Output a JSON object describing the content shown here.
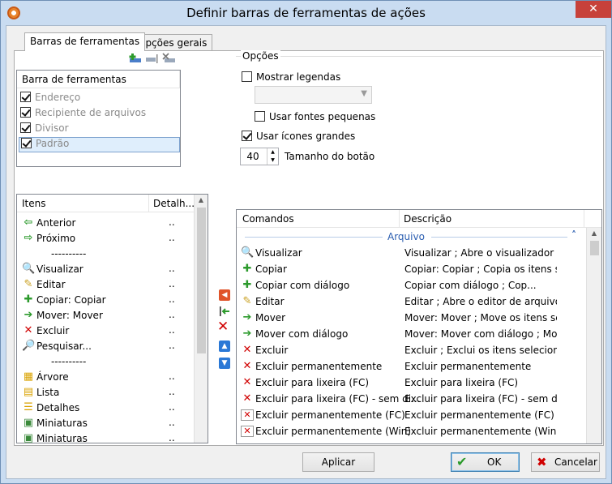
{
  "window": {
    "title": "Definir barras de ferramentas de ações",
    "close_label": "✕"
  },
  "tabs": [
    {
      "label": "Barras de ferramentas"
    },
    {
      "label": "Opções gerais"
    }
  ],
  "toolbars_box": {
    "header": "Barra de ferramentas",
    "rows": [
      {
        "label": "Endereço",
        "checked": true
      },
      {
        "label": "Recipiente de arquivos",
        "checked": true
      },
      {
        "label": "Divisor",
        "checked": true
      },
      {
        "label": "Padrão",
        "checked": true
      }
    ]
  },
  "items_box": {
    "col_items": "Itens",
    "col_detail": "Detalh...",
    "rows": [
      {
        "icon": "arrow-left-icon",
        "label": "Anterior",
        "detail": ".."
      },
      {
        "icon": "arrow-right-icon",
        "label": "Próximo",
        "detail": ".."
      },
      {
        "icon": "",
        "label": "----------",
        "detail": ""
      },
      {
        "icon": "view-icon",
        "label": "Visualizar",
        "detail": ".."
      },
      {
        "icon": "edit-icon",
        "label": "Editar",
        "detail": ".."
      },
      {
        "icon": "copy-icon",
        "label": "Copiar: Copiar",
        "detail": ".."
      },
      {
        "icon": "move-icon",
        "label": "Mover: Mover",
        "detail": ".."
      },
      {
        "icon": "delete-icon",
        "label": "Excluir",
        "detail": ".."
      },
      {
        "icon": "search-icon",
        "label": "Pesquisar...",
        "detail": ".."
      },
      {
        "icon": "",
        "label": "----------",
        "detail": ""
      },
      {
        "icon": "tree-icon",
        "label": "Árvore",
        "detail": ".."
      },
      {
        "icon": "list-icon",
        "label": "Lista",
        "detail": ".."
      },
      {
        "icon": "details-icon",
        "label": "Detalhes",
        "detail": ".."
      },
      {
        "icon": "thumbnails-icon",
        "label": "Miniaturas",
        "detail": ".."
      },
      {
        "icon": "thumbnails-icon",
        "label": "Miniaturas",
        "detail": ".."
      }
    ]
  },
  "options": {
    "group_label": "Opções",
    "show_captions": {
      "label": "Mostrar legendas",
      "checked": false
    },
    "small_fonts": {
      "label": "Usar fontes pequenas",
      "checked": false
    },
    "large_icons": {
      "label": "Usar ícones grandes",
      "checked": true
    },
    "button_size": {
      "value": "40",
      "label": "Tamanho do botão"
    }
  },
  "commands_box": {
    "col_commands": "Comandos",
    "col_description": "Descrição",
    "group": "Arquivo",
    "rows": [
      {
        "icon": "view-icon",
        "label": "Visualizar",
        "desc": "Visualizar ; Abre o visualizador int..."
      },
      {
        "icon": "copy-icon",
        "label": "Copiar",
        "desc": "Copiar: Copiar ; Copia os itens sel..."
      },
      {
        "icon": "copy-icon",
        "label": "Copiar com diálogo",
        "desc": "Copiar com diálogo ; Cop..."
      },
      {
        "icon": "edit-icon",
        "label": "Editar",
        "desc": "Editar ; Abre o editor de arquivos ..."
      },
      {
        "icon": "move-icon",
        "label": "Mover",
        "desc": "Mover: Mover ; Move os itens sel..."
      },
      {
        "icon": "move-icon",
        "label": "Mover com diálogo",
        "desc": "Mover: Mover com diálogo ; Mov..."
      },
      {
        "icon": "delete-icon",
        "label": "Excluir",
        "desc": "Excluir ; Exclui os itens selecionad..."
      },
      {
        "icon": "delete-icon",
        "label": "Excluir permanentemente",
        "desc": "Excluir permanentemente"
      },
      {
        "icon": "delete-icon",
        "label": "Excluir para lixeira (FC)",
        "desc": "Excluir para lixeira (FC)"
      },
      {
        "icon": "delete-icon",
        "label": "Excluir para lixeira (FC) - sem di...",
        "desc": "Excluir para lixeira (FC) - sem diál..."
      },
      {
        "icon": "delete-permanent-icon",
        "label": "Excluir permanentemente (FC)",
        "desc": "Excluir permanentemente (FC)"
      },
      {
        "icon": "delete-permanent-icon",
        "label": "Excluir permanentemente (Win)",
        "desc": "Excluir permanentemente (Win)"
      }
    ]
  },
  "buttons": {
    "apply": "Aplicar",
    "ok": "OK",
    "cancel": "Cancelar"
  }
}
